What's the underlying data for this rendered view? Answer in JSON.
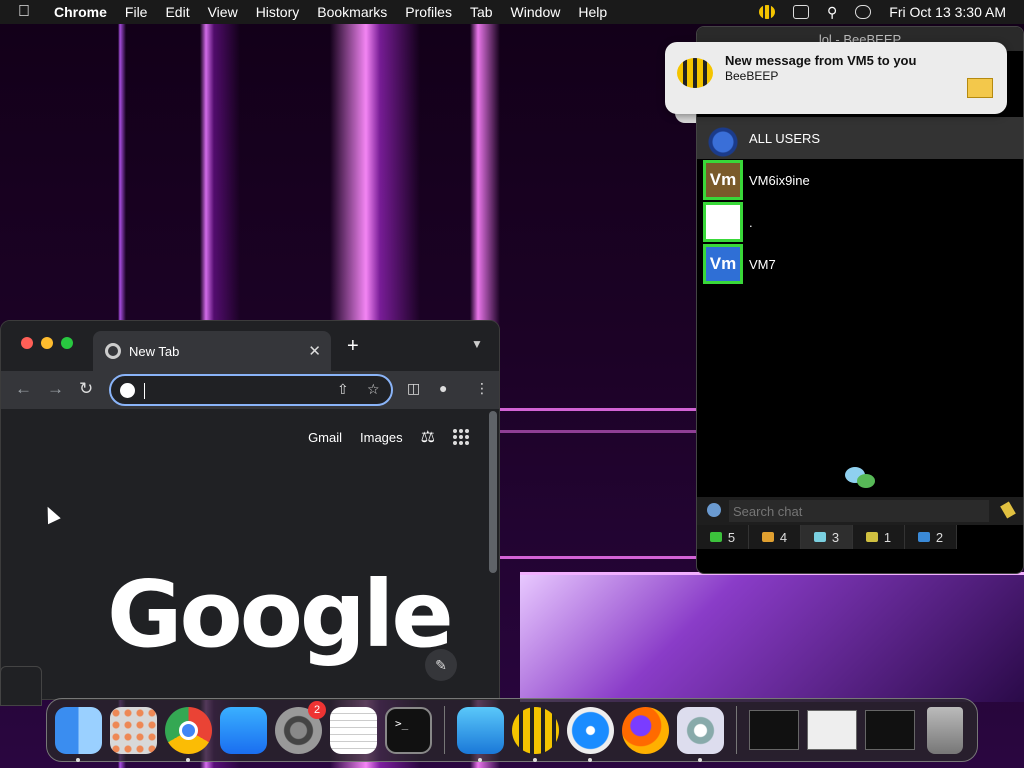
{
  "menubar": {
    "items": [
      "Chrome",
      "File",
      "Edit",
      "View",
      "History",
      "Bookmarks",
      "Profiles",
      "Tab",
      "Window",
      "Help"
    ],
    "clock": "Fri Oct 13  3:30 AM"
  },
  "chrome": {
    "tab_title": "New Tab",
    "omnibox_value": "",
    "links": {
      "gmail": "Gmail",
      "images": "Images"
    },
    "logo": "Google"
  },
  "notification": {
    "title": "New message from VM5 to you",
    "subtitle": "BeeBEEP"
  },
  "beebeep": {
    "window_title": "lol - BeeBEEP",
    "users": [
      {
        "name": "ALL USERS",
        "avatar": ""
      },
      {
        "name": "VM6ix9ine",
        "avatar": "Vm",
        "color": "#7a5a2a"
      },
      {
        "name": ".",
        "avatar": "",
        "color": "#ffffff"
      },
      {
        "name": "VM7",
        "avatar": "Vm",
        "color": "#2f6fd6"
      }
    ],
    "search_placeholder": "Search chat",
    "tabs": [
      {
        "count": "5",
        "icon_color": "#3cc23c"
      },
      {
        "count": "4",
        "icon_color": "#e0a030"
      },
      {
        "count": "3",
        "icon_color": "#7ad0e0"
      },
      {
        "count": "1",
        "icon_color": "#d0c040"
      },
      {
        "count": "2",
        "icon_color": "#3a8ad8"
      }
    ]
  },
  "dock": {
    "settings_badge": "2"
  }
}
